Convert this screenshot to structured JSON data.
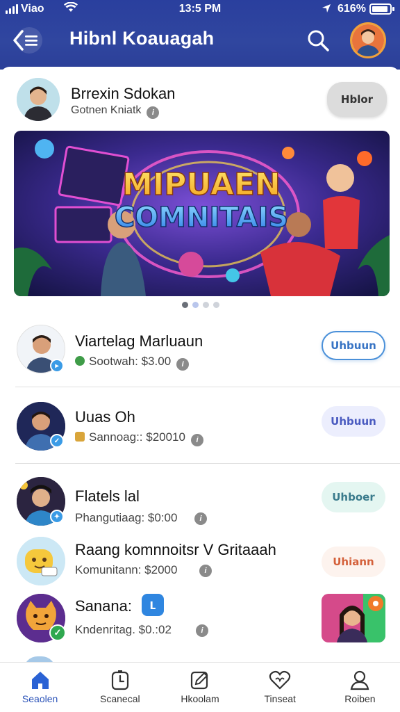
{
  "status_bar": {
    "carrier": "Viao",
    "time": "13:5 PM",
    "battery": "616%"
  },
  "header": {
    "title": "Hibnl Koauagah"
  },
  "featured": {
    "name": "Brrexin Sdokan",
    "subtitle": "Gotnen Kniatk",
    "action_label": "Hblor"
  },
  "banner": {
    "headline_line1": "MIPUAEN",
    "headline_line2": "COMNITAIS",
    "carousel_count": 4,
    "carousel_active": 1
  },
  "list": [
    {
      "name": "Viartelag Marluaun",
      "subtitle": "Sootwah: $3.00",
      "action_label": "Uhbuun",
      "badge_color": "#3a9be6"
    },
    {
      "name": "Uuas Oh",
      "subtitle": "Sannoag:: $20010",
      "action_label": "Uhbuun",
      "badge_color": "#3a9be6"
    },
    {
      "name": "Flatels lal",
      "subtitle": "Phangutiaag: $0:00",
      "action_label": "Uhboer",
      "badge_color": "#3a9be6"
    },
    {
      "name": "Raang komnnoitsr V Gritaaah",
      "subtitle": "Komunitann: $2000",
      "action_label": "Uhiann",
      "badge_color": ""
    },
    {
      "name": "Sanana:",
      "subtitle": "Kndenritag. $0.:02",
      "action_label": "",
      "badge_color": "#2fa84f"
    }
  ],
  "bottom_nav": [
    {
      "label": "Seaolen",
      "icon": "home-icon",
      "active": true
    },
    {
      "label": "Scanecal",
      "icon": "timer-icon",
      "active": false
    },
    {
      "label": "Hkoolam",
      "icon": "pencil-icon",
      "active": false
    },
    {
      "label": "Tinseat",
      "icon": "heart-icon",
      "active": false
    },
    {
      "label": "Roiben",
      "icon": "user-icon",
      "active": false
    }
  ],
  "colors": {
    "header_bg": "#2b3f9e",
    "accent_blue": "#2a52b8",
    "pill_outline_blue": "#4a90d9"
  }
}
